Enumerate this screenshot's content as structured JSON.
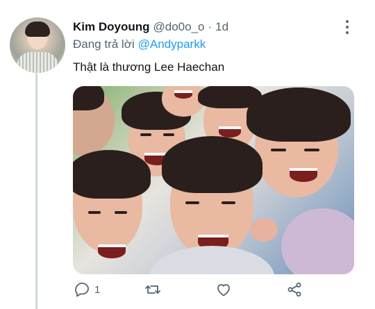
{
  "author": {
    "name": "Kim Doyoung",
    "handle": "@do0o_o",
    "separator": "·",
    "time": "1d"
  },
  "reply": {
    "prefix": "Đang trả lời",
    "mention": "@Andyparkk"
  },
  "tweet": {
    "text": "Thật là thương Lee Haechan"
  },
  "actions": {
    "reply_count": "1",
    "retweet_count": "",
    "like_count": ""
  },
  "colors": {
    "link": "#1d9bf0",
    "secondary_text": "#536471",
    "thread_line": "#cfd9de"
  }
}
